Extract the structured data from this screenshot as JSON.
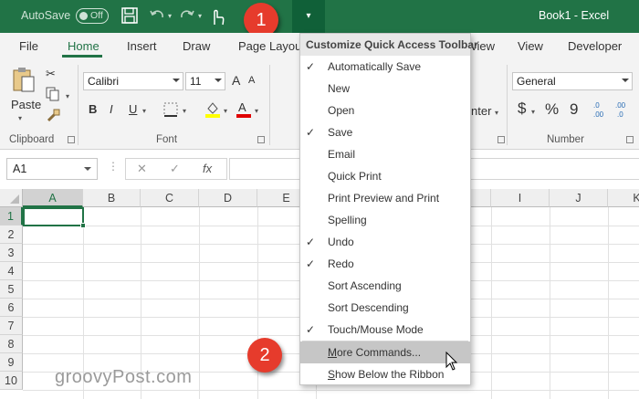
{
  "titlebar": {
    "autosave_label": "AutoSave",
    "autosave_state": "Off",
    "title": "Book1  -  Excel",
    "callout_1": "1",
    "callout_2": "2"
  },
  "tabs": [
    "File",
    "Home",
    "Insert",
    "Draw",
    "Page Layou",
    "view",
    "View",
    "Developer"
  ],
  "ribbon": {
    "paste_label": "Paste",
    "clipboard_label": "Clipboard",
    "font_name": "Calibri",
    "font_size": "11",
    "font_label": "Font",
    "number_format": "General",
    "number_label": "Number",
    "bold": "B",
    "italic": "I",
    "underline": "U",
    "align_partial": "nter",
    "currency": "$",
    "percent": "%",
    "comma": "9"
  },
  "formula_bar": {
    "name_box": "A1",
    "fx": "fx"
  },
  "grid": {
    "columns": [
      "A",
      "B",
      "C",
      "D",
      "E",
      "I",
      "J",
      "K"
    ],
    "rows": [
      "1",
      "2",
      "3",
      "4",
      "5",
      "6",
      "7",
      "8",
      "9",
      "10"
    ]
  },
  "menu": {
    "header": "Customize Quick Access Toolbar",
    "items": [
      {
        "label": "Automatically Save",
        "checked": true
      },
      {
        "label": "New",
        "checked": false
      },
      {
        "label": "Open",
        "checked": false
      },
      {
        "label": "Save",
        "checked": true
      },
      {
        "label": "Email",
        "checked": false
      },
      {
        "label": "Quick Print",
        "checked": false
      },
      {
        "label": "Print Preview and Print",
        "checked": false
      },
      {
        "label": "Spelling",
        "checked": false
      },
      {
        "label": "Undo",
        "checked": true
      },
      {
        "label": "Redo",
        "checked": true
      },
      {
        "label": "Sort Ascending",
        "checked": false
      },
      {
        "label": "Sort Descending",
        "checked": false
      },
      {
        "label": "Touch/Mouse Mode",
        "checked": true
      },
      {
        "label": "More Commands...",
        "checked": false
      },
      {
        "label": "Show Below the Ribbon",
        "checked": false
      }
    ],
    "check_glyph": "✓"
  },
  "watermark": "groovyPost.com",
  "colors": {
    "excel_green": "#217346",
    "callout_red": "#e63b2c"
  }
}
